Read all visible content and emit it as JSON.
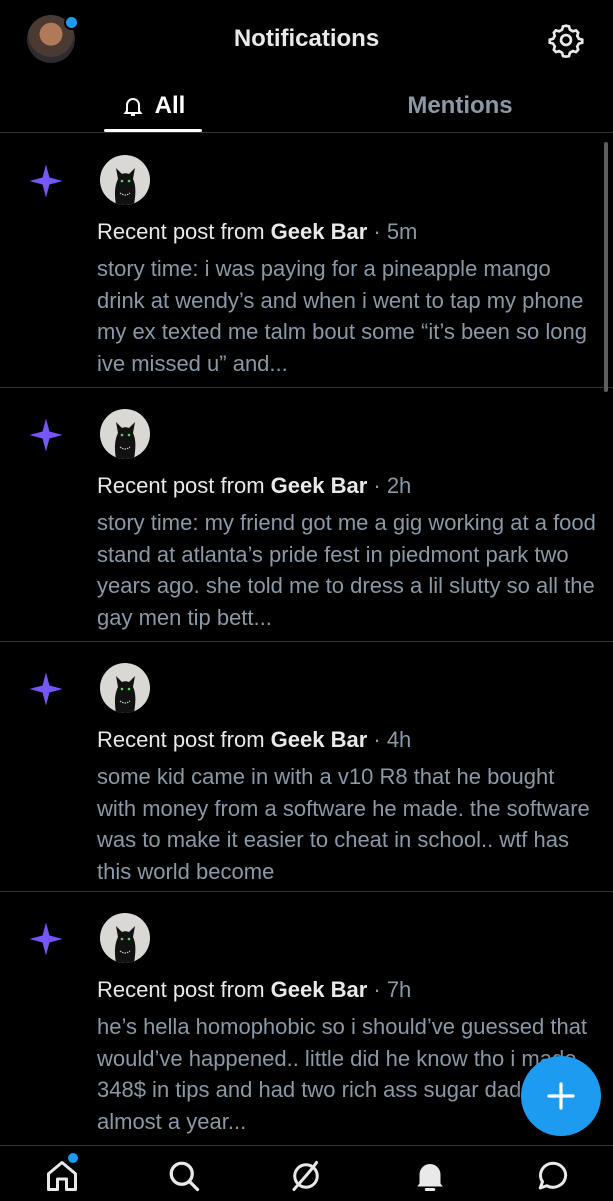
{
  "header": {
    "title": "Notifications"
  },
  "tabs": [
    {
      "label": "All"
    },
    {
      "label": "Mentions"
    }
  ],
  "notifications": [
    {
      "prefix": "Recent post from ",
      "author": "Geek Bar",
      "time": " · 5m",
      "body": "story time: i was paying for a pineapple mango drink at wendy’s and when i went to tap my phone my ex texted me talm bout some “it’s been so long ive missed u” and..."
    },
    {
      "prefix": "Recent post from ",
      "author": "Geek Bar",
      "time": " · 2h",
      "body": "story time: my friend got me a gig working at a food stand at atlanta’s pride fest in piedmont park two years ago. she told me to dress a lil slutty so all the gay men tip bett..."
    },
    {
      "prefix": "Recent post from ",
      "author": "Geek Bar",
      "time": " · 4h",
      "body": "some kid came in with a v10 R8 that he bought with money from a software he made. the software was to make it easier to cheat in school.. wtf has this world become"
    },
    {
      "prefix": "Recent post from ",
      "author": "Geek Bar",
      "time": " · 7h",
      "body": "he’s hella homophobic so i should’ve guessed that would’ve happened.. little did he know tho i made 348$ in tips and had two rich ass sugar daddys for almost a year..."
    }
  ],
  "colors": {
    "accent": "#1d9bf0",
    "sparkle": "#7856ff",
    "background": "#000000"
  },
  "icons": {
    "sparkle": "sparkle-icon",
    "settings": "gear-icon",
    "compose": "plus-icon"
  }
}
